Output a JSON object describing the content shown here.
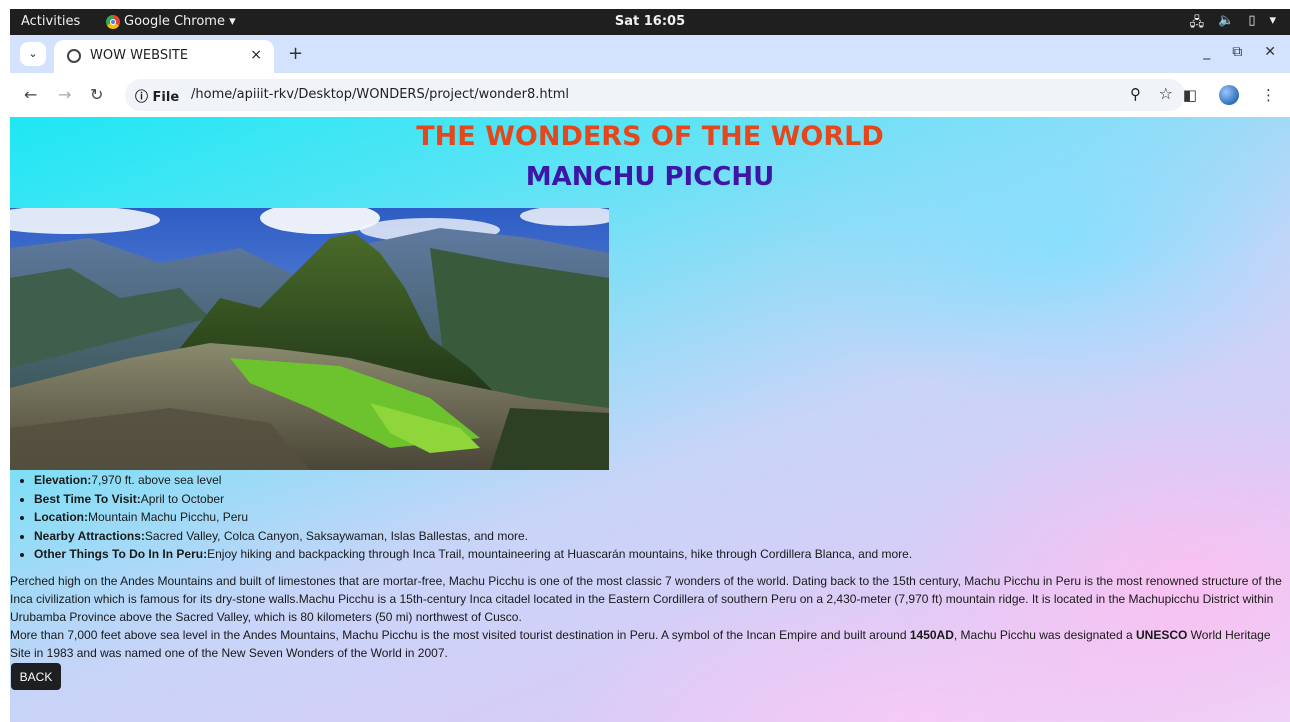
{
  "system_bar": {
    "activities": "Activities",
    "app_name": "Google Chrome ▾",
    "clock": "Sat 16:05"
  },
  "browser": {
    "tab_title": "WOW WEBSITE",
    "tab_close": "×",
    "new_tab": "+",
    "site_chip": "ⓘ File",
    "url": "/home/apiiit-rkv/Desktop/WONDERS/project/wonder8.html"
  },
  "page": {
    "heading": "THE WONDERS OF THE WORLD",
    "subheading": "MANCHU PICCHU",
    "facts": [
      {
        "label": "Elevation:",
        "value": "7,970 ft. above sea level"
      },
      {
        "label": "Best Time To Visit:",
        "value": "April to October"
      },
      {
        "label": "Location:",
        "value": "Mountain Machu Picchu, Peru"
      },
      {
        "label": "Nearby Attractions:",
        "value": "Sacred Valley, Colca Canyon, Saksaywaman, Islas Ballestas, and more."
      },
      {
        "label": "Other Things To Do In In Peru:",
        "value": "Enjoy hiking and backpacking through Inca Trail, mountaineering at Huascarán mountains, hike through Cordillera Blanca, and more."
      }
    ],
    "paragraph1": "Perched high on the Andes Mountains and built of limestones that are mortar-free, Machu Picchu is one of the most classic 7 wonders of the world. Dating back to the 15th century, Machu Picchu in Peru is the most renowned structure of the Inca civilization which is famous for its dry-stone walls.Machu Picchu is a 15th-century Inca citadel located in the Eastern Cordillera of southern Peru on a 2,430-meter (7,970 ft) mountain ridge. It is located in the Machupicchu District within Urubamba Province above the Sacred Valley, which is 80 kilometers (50 mi) northwest of Cusco.",
    "paragraph2_a": "More than 7,000 feet above sea level in the Andes Mountains, Machu Picchu is the most visited tourist destination in Peru. A symbol of the Incan Empire and built around ",
    "paragraph2_bold1": "1450AD",
    "paragraph2_b": ", Machu Picchu was designated a ",
    "paragraph2_bold2": "UNESCO",
    "paragraph2_c": " World Heritage Site in 1983 and was named one of the New Seven Wonders of the World in 2007.",
    "back_button": "BACK"
  },
  "colors": {
    "heading": "#e5471c",
    "subheading": "#3d16a8",
    "back_button_bg": "#1d1f23"
  }
}
